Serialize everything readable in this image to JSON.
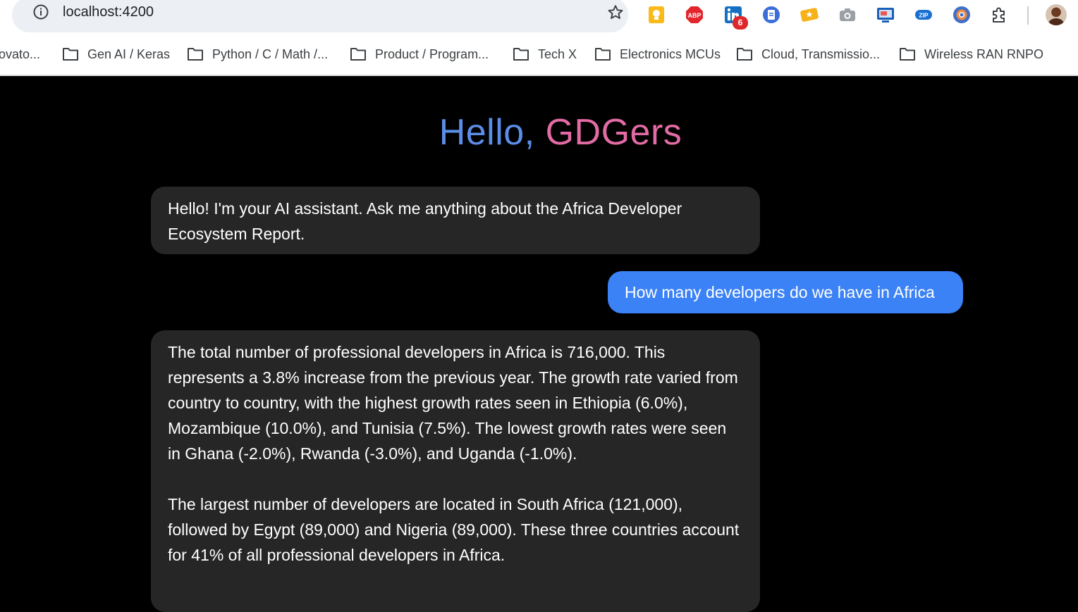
{
  "browser": {
    "url": "localhost:4200",
    "extension_badge": "6",
    "bookmarks": [
      {
        "label": "ovato..."
      },
      {
        "label": "Gen AI / Keras"
      },
      {
        "label": "Python / C / Math /..."
      },
      {
        "label": "Product / Program..."
      },
      {
        "label": "Tech X"
      },
      {
        "label": "Electronics MCUs"
      },
      {
        "label": "Cloud, Transmissio..."
      },
      {
        "label": "Wireless RAN RNPO"
      }
    ]
  },
  "app": {
    "greeting_hello": "Hello,",
    "greeting_name": "GDGers",
    "messages": [
      {
        "role": "assistant",
        "text": "Hello! I'm your AI assistant. Ask me anything about the Africa Developer Ecosystem Report."
      },
      {
        "role": "user",
        "text": "How many developers do we have in Africa"
      },
      {
        "role": "assistant",
        "paragraph1": "The total number of professional developers in Africa is 716,000. This represents a 3.8% increase from the previous year. The growth rate varied from country to country, with the highest growth rates seen in Ethiopia (6.0%), Mozambique (10.0%), and Tunisia (7.5%). The lowest growth rates were seen in Ghana (-2.0%), Rwanda (-3.0%), and Uganda (-1.0%).",
        "paragraph2": "The largest number of developers are located in South Africa (121,000), followed by Egypt (89,000) and Nigeria (89,000). These three countries account for 41% of all professional developers in Africa."
      }
    ]
  },
  "colors": {
    "greeting_hello": "#5b8ee8",
    "greeting_name": "#e36ba5",
    "assistant_bubble": "#262626",
    "user_bubble": "#3b82f6"
  }
}
